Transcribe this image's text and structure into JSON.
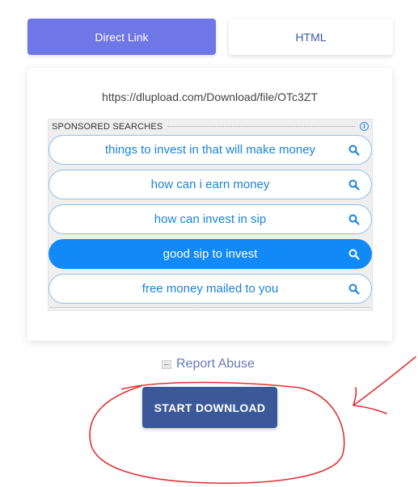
{
  "tabs": {
    "direct_link": "Direct Link",
    "html": "HTML"
  },
  "link": {
    "url": "https://dlupload.com/Download/file/OTc3ZT"
  },
  "sponsored": {
    "title": "SPONSORED SEARCHES",
    "info_icon": "info-icon",
    "items": [
      {
        "label": "things to invest in that will make money",
        "active": false
      },
      {
        "label": "how can i earn money",
        "active": false
      },
      {
        "label": "how can invest in sip",
        "active": false
      },
      {
        "label": "good sip to invest",
        "active": true
      },
      {
        "label": "free money mailed to you",
        "active": false
      }
    ]
  },
  "report": {
    "label": "Report Abuse",
    "icon": "flag-icon"
  },
  "download": {
    "label": "START DOWNLOAD"
  },
  "colors": {
    "tab_active": "#6f76e6",
    "pill_active": "#118af8",
    "pill_text": "#1a84d8",
    "button": "#3b5998",
    "annotation": "#e03030"
  }
}
